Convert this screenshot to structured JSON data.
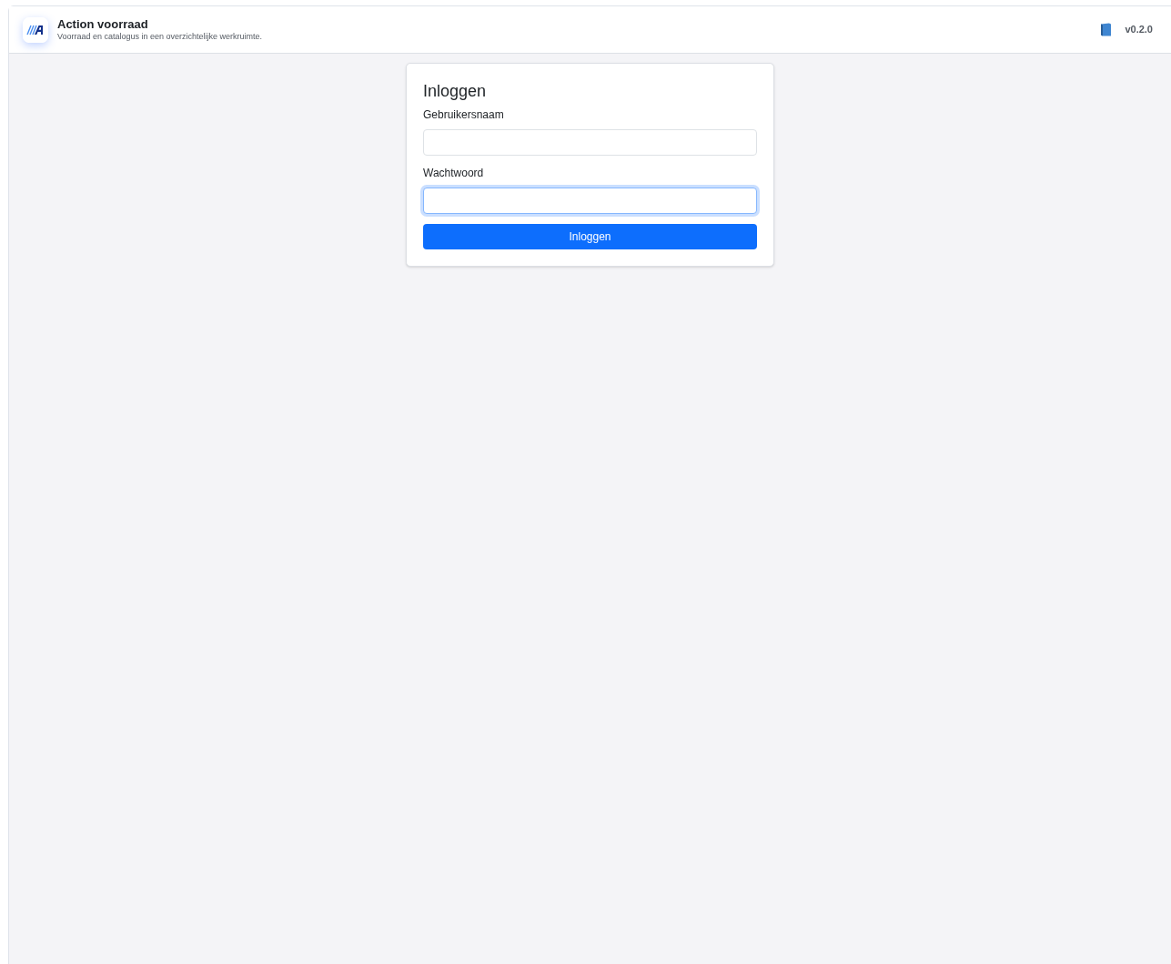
{
  "header": {
    "title": "Action voorraad",
    "subtitle": "Voorraad en catalogus in een overzichtelijke werkruimte.",
    "version": "v0.2.0"
  },
  "login": {
    "title": "Inloggen",
    "fields": [
      {
        "label": "Gebruikersnaam",
        "focused": false
      },
      {
        "label": "Wachtwoord",
        "focused": true
      }
    ],
    "button": "Inloggen"
  }
}
